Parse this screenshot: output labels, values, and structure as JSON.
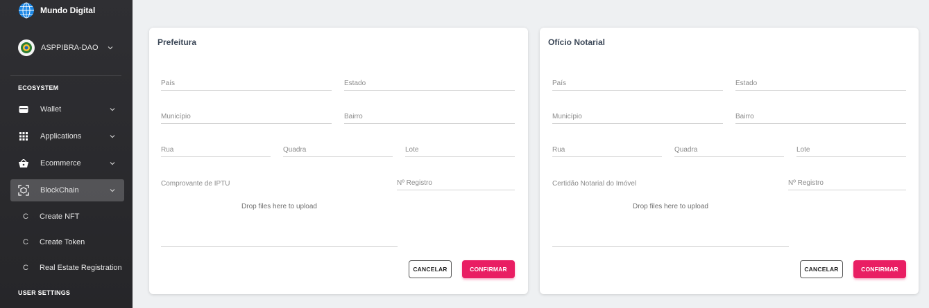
{
  "sidebar": {
    "brand": "Mundo Digital",
    "org": "ASPPIBRA-DAO",
    "section_ecosystem": "ECOSYSTEM",
    "items": [
      {
        "label": "Wallet",
        "icon": "wallet-icon"
      },
      {
        "label": "Applications",
        "icon": "apps-grid-icon"
      },
      {
        "label": "Ecommerce",
        "icon": "basket-icon"
      },
      {
        "label": "BlockChain",
        "icon": "blockchain-icon"
      }
    ],
    "subitems": [
      {
        "mini": "C",
        "label": "Create NFT"
      },
      {
        "mini": "C",
        "label": "Create Token"
      },
      {
        "mini": "C",
        "label": "Real Estate Registration"
      }
    ],
    "section_user": "USER SETTINGS"
  },
  "cards": [
    {
      "title": "Prefeitura",
      "fields": {
        "pais": "País",
        "estado": "Estado",
        "municipio": "Município",
        "bairro": "Bairro",
        "rua": "Rua",
        "quadra": "Quadra",
        "lote": "Lote",
        "doc": "Comprovante de IPTU",
        "registro": "Nº Registro"
      },
      "dropzone": "Drop files here to upload",
      "cancel": "CANCELAR",
      "confirm": "CONFIRMAR"
    },
    {
      "title": "Ofício Notarial",
      "fields": {
        "pais": "País",
        "estado": "Estado",
        "municipio": "Município",
        "bairro": "Bairro",
        "rua": "Rua",
        "quadra": "Quadra",
        "lote": "Lote",
        "doc": "Certidão Notarial do Imóvel",
        "registro": "Nº Registro"
      },
      "dropzone": "Drop files here to upload",
      "cancel": "CANCELAR",
      "confirm": "CONFIRMAR"
    }
  ],
  "colors": {
    "sidebar_bg": "#2f2f33",
    "confirm_button": "#e91e63",
    "page_bg": "#eef0f2"
  }
}
